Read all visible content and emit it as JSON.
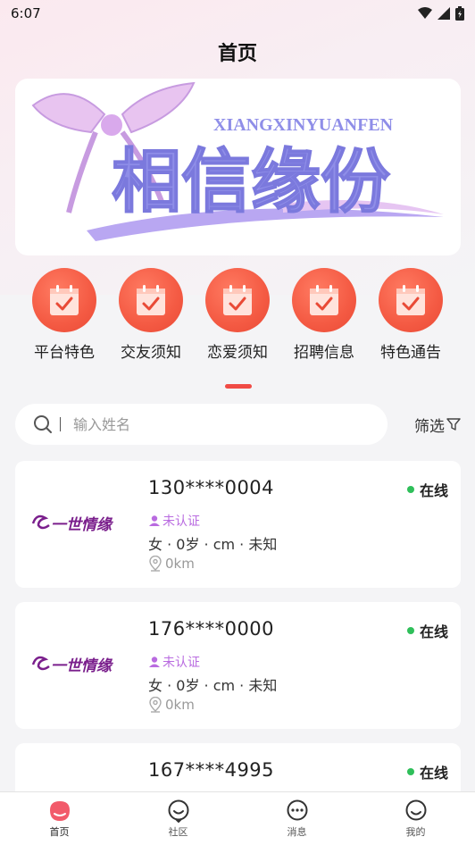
{
  "status_bar": {
    "time": "6:07"
  },
  "header": {
    "title": "首页"
  },
  "banner": {
    "latin": "XIANGXINYUANFEN",
    "title": "相信缘份"
  },
  "menu": {
    "items": [
      {
        "label": "平台特色",
        "icon": "calendar-check-icon"
      },
      {
        "label": "交友须知",
        "icon": "calendar-check-icon"
      },
      {
        "label": "恋爱须知",
        "icon": "calendar-check-icon"
      },
      {
        "label": "招聘信息",
        "icon": "calendar-check-icon"
      },
      {
        "label": "特色通告",
        "icon": "calendar-check-icon"
      }
    ]
  },
  "search": {
    "placeholder": "输入姓名",
    "filter_label": "筛选"
  },
  "cards": [
    {
      "name": "130****0004",
      "status": "在线",
      "verify": "未认证",
      "info": "女 · 0岁 · cm · 未知",
      "distance": "0km",
      "logo_text": "一世情缘"
    },
    {
      "name": "176****0000",
      "status": "在线",
      "verify": "未认证",
      "info": "女 · 0岁 · cm · 未知",
      "distance": "0km",
      "logo_text": "一世情缘"
    },
    {
      "name": "167****4995",
      "status": "在线",
      "verify": "",
      "info": "",
      "distance": "",
      "logo_text": ""
    }
  ],
  "tabbar": {
    "items": [
      {
        "label": "首页",
        "icon": "home-icon",
        "active": true
      },
      {
        "label": "社区",
        "icon": "community-icon",
        "active": false
      },
      {
        "label": "消息",
        "icon": "message-icon",
        "active": false
      },
      {
        "label": "我的",
        "icon": "profile-icon",
        "active": false
      }
    ]
  },
  "colors": {
    "accent": "#f04b45",
    "online": "#2fbf5a",
    "verify": "#b96be0",
    "banner_text": "#8f8ee8"
  }
}
